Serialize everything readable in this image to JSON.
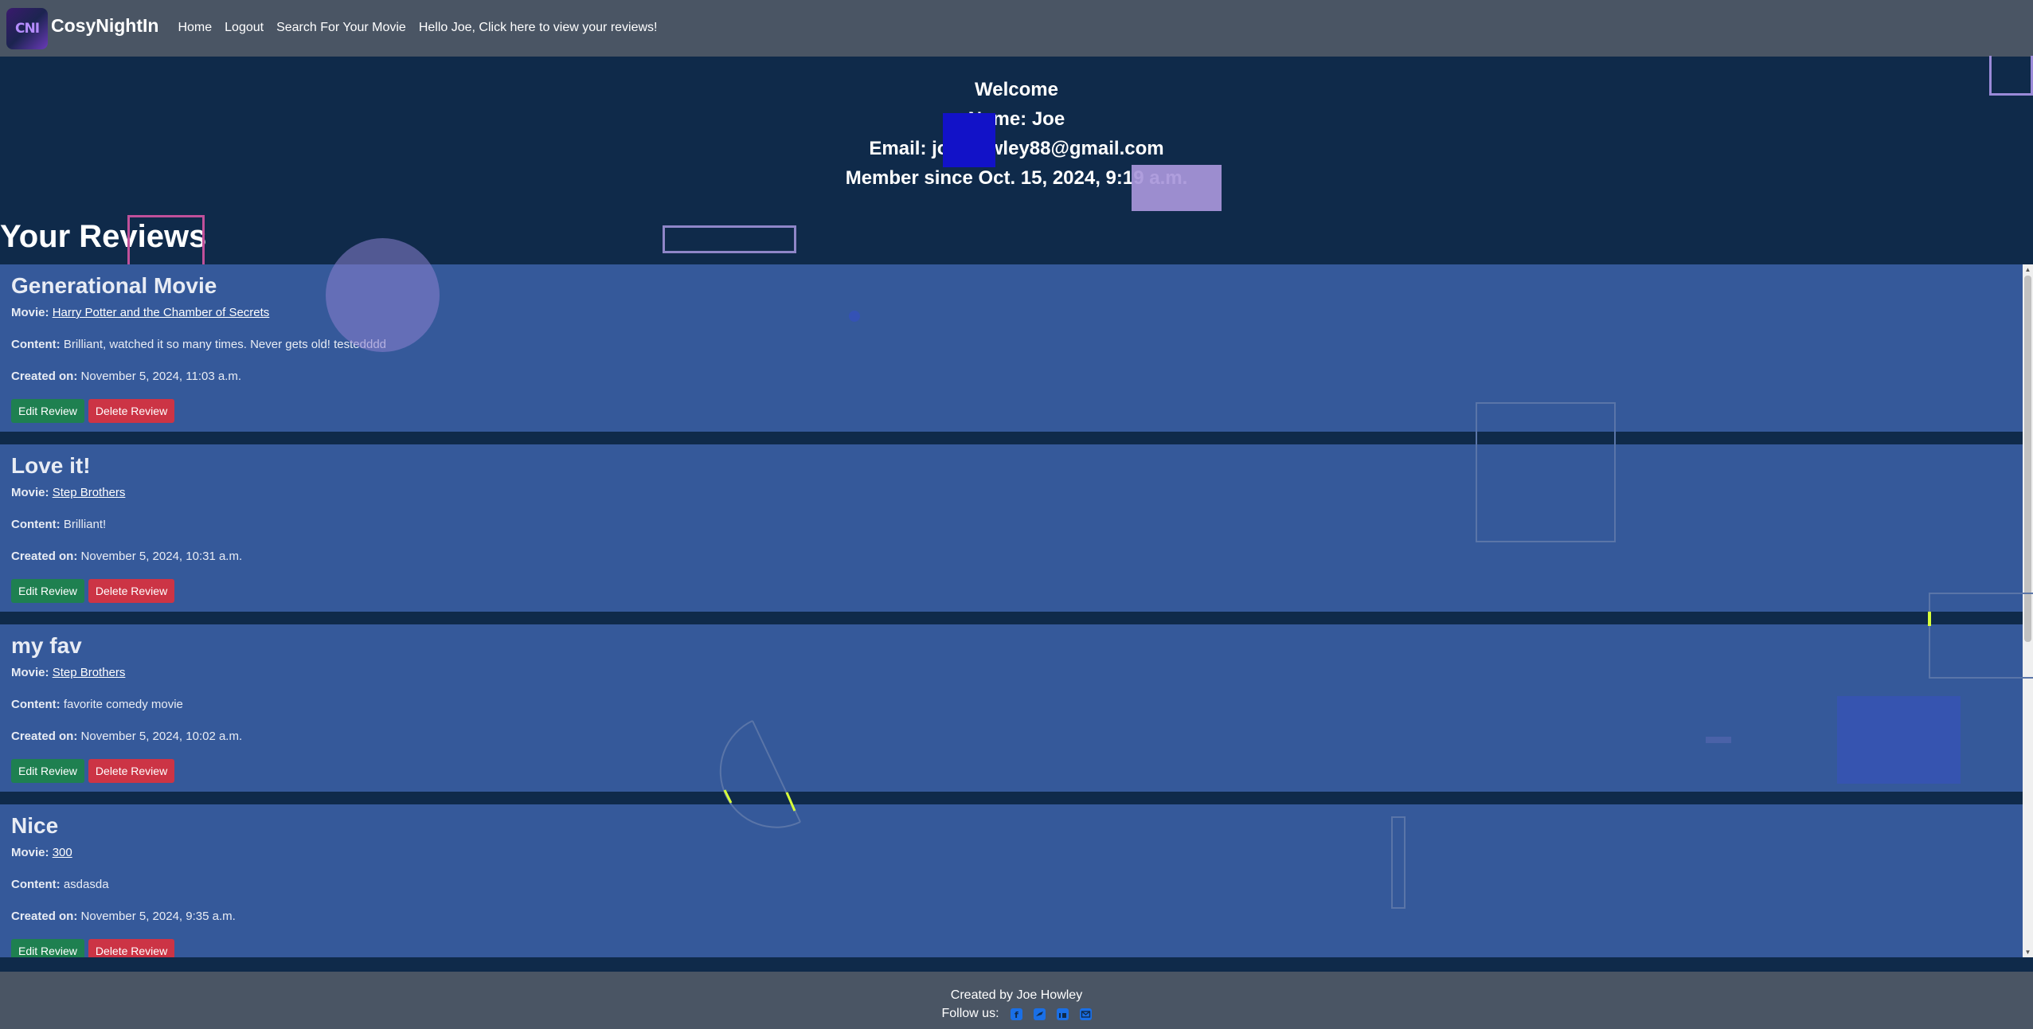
{
  "nav": {
    "logo_text": "CNI",
    "brand": "CosyNightIn",
    "links": [
      "Home",
      "Logout",
      "Search For Your Movie",
      "Hello Joe, Click here to view your reviews!"
    ]
  },
  "profile": {
    "welcome": "Welcome",
    "name": "Name: Joe",
    "email": "Email: joe.howley88@gmail.com",
    "member_since": "Member since Oct. 15, 2024, 9:19 a.m."
  },
  "reviews_heading": "Your Reviews",
  "labels": {
    "movie": "Movie:",
    "content": "Content:",
    "created": "Created on:",
    "edit": "Edit Review",
    "delete": "Delete Review"
  },
  "reviews": [
    {
      "title": "Generational Movie",
      "movie": "Harry Potter and the Chamber of Secrets",
      "content": "Brilliant, watched it so many times. Never gets old! testedddd",
      "created": "November 5, 2024, 11:03 a.m."
    },
    {
      "title": "Love it!",
      "movie": "Step Brothers",
      "content": "Brilliant!",
      "created": "November 5, 2024, 10:31 a.m."
    },
    {
      "title": "my fav",
      "movie": "Step Brothers",
      "content": "favorite comedy movie",
      "created": "November 5, 2024, 10:02 a.m."
    },
    {
      "title": "Nice",
      "movie": "300",
      "content": "asdasda",
      "created": "November 5, 2024, 9:35 a.m."
    }
  ],
  "footer": {
    "credit": "Created by Joe Howley",
    "follow": "Follow us:",
    "social_icons": [
      "facebook-icon",
      "twitter-icon",
      "linkedin-icon",
      "email-icon"
    ]
  },
  "colors": {
    "navbar": "#4a5564",
    "page_bg": "#0f2a4a",
    "card_bg": "#35599a",
    "edit_button": "#1e8050",
    "delete_button": "#cc3445",
    "social_icon": "#1a6fe6"
  }
}
